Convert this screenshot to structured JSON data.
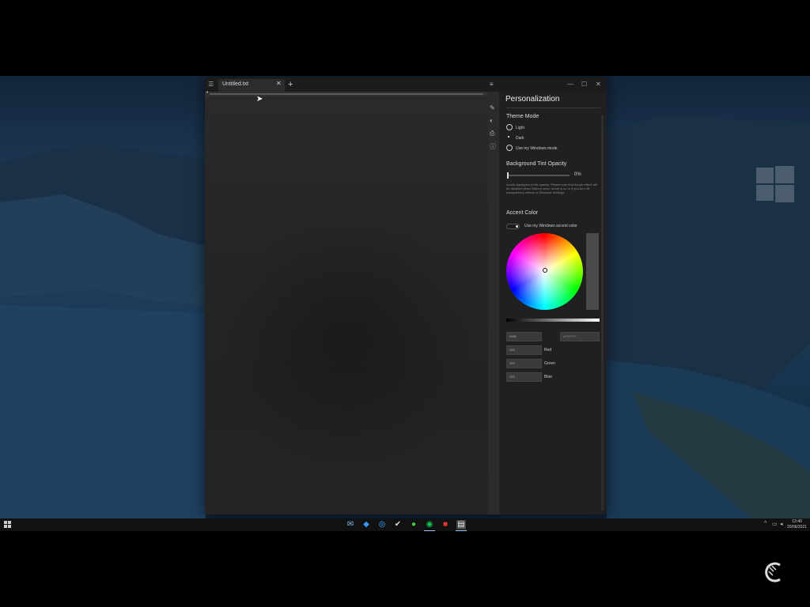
{
  "tab": {
    "title": "Untitled.txt",
    "close_glyph": "✕",
    "new_glyph": "+"
  },
  "window_controls": {
    "minimize": "—",
    "maximize": "☐",
    "close": "✕"
  },
  "rail_icons": [
    "brush-icon",
    "palette-icon",
    "printer-icon",
    "info-icon"
  ],
  "panel": {
    "title": "Personalization",
    "theme_mode": {
      "heading": "Theme Mode",
      "options": [
        "Light",
        "Dark",
        "Use my Windows mode"
      ],
      "selected": "Dark"
    },
    "tint": {
      "heading": "Background Tint Opacity",
      "value": "0%",
      "level": 0,
      "description": "Acrylic background tint opacity. Please note that Acrylic effect will be disabled when Battery saver mode is on or if you turn off transparency effects in Windows Settings."
    },
    "accent": {
      "heading": "Accent Color",
      "use_windows": "Use my Windows accent color",
      "toggle_on": true,
      "color_model": "RGB",
      "hex_placeholder": "#FFFFFF",
      "channels": [
        {
          "label": "Red",
          "value": "255"
        },
        {
          "label": "Green",
          "value": "255"
        },
        {
          "label": "Blue",
          "value": "255"
        }
      ]
    }
  },
  "clock": {
    "time": "13:40",
    "date": "20/06/2021"
  }
}
